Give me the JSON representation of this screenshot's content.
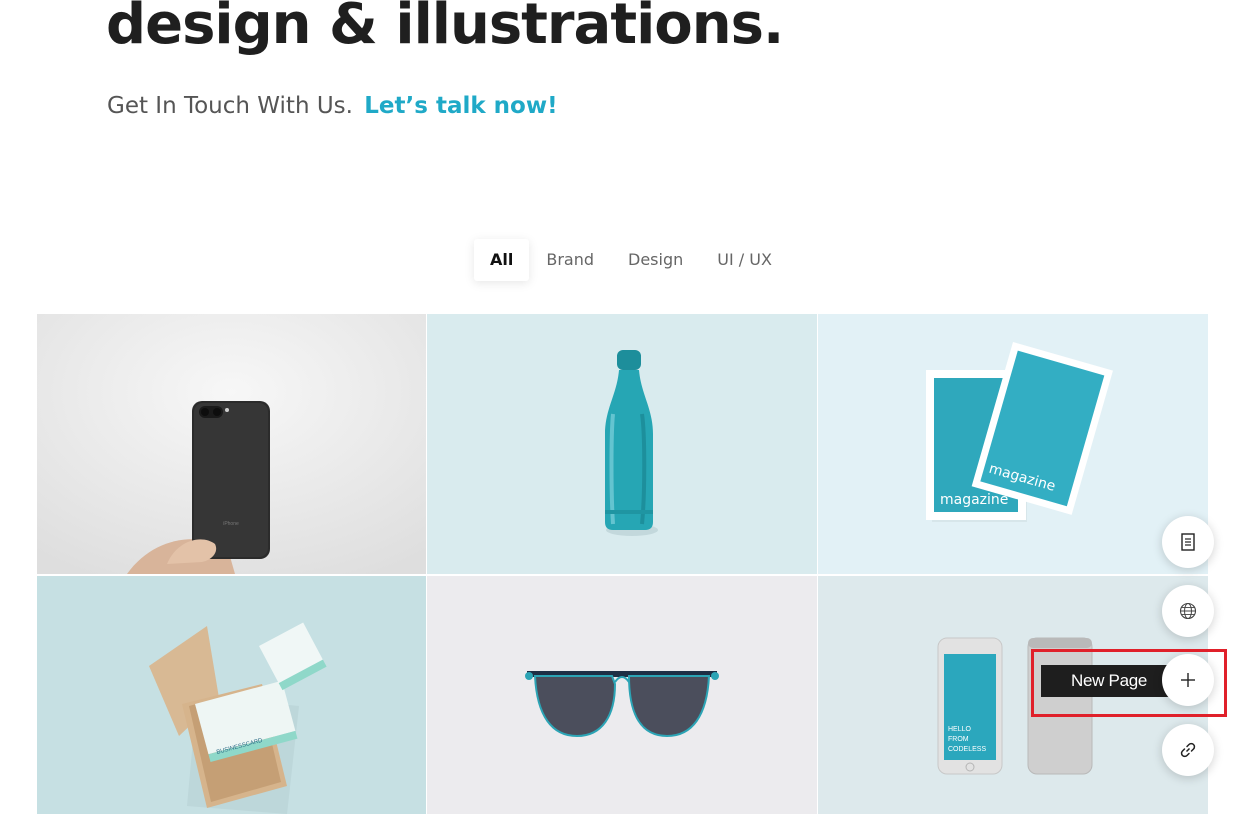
{
  "hero": {
    "title": "design & illustrations.",
    "subtitle": "Get In Touch With Us.",
    "cta": "Let’s talk now!"
  },
  "filters": {
    "items": [
      "All",
      "Brand",
      "Design",
      "UI / UX"
    ],
    "active": "All"
  },
  "portfolio": {
    "tiles": [
      {
        "name": "iphone-mockup",
        "image_text": "iPhone"
      },
      {
        "name": "water-bottle-mockup"
      },
      {
        "name": "magazine-mockup",
        "image_text": "magazine"
      },
      {
        "name": "business-card-mockup",
        "image_text": "BUSINESSCARD"
      },
      {
        "name": "sunglasses-mockup"
      },
      {
        "name": "smartphones-mockup",
        "image_text": "HELLO FROM CODELESS"
      }
    ]
  },
  "floating_actions": {
    "buttons": [
      {
        "icon": "document-icon"
      },
      {
        "icon": "globe-icon"
      },
      {
        "icon": "plus-icon",
        "tooltip": "New Page"
      },
      {
        "icon": "link-icon"
      }
    ]
  },
  "colors": {
    "accent": "#1fa9c7",
    "highlight": "#e0202a",
    "tooltip_bg": "#1e1e1e"
  }
}
